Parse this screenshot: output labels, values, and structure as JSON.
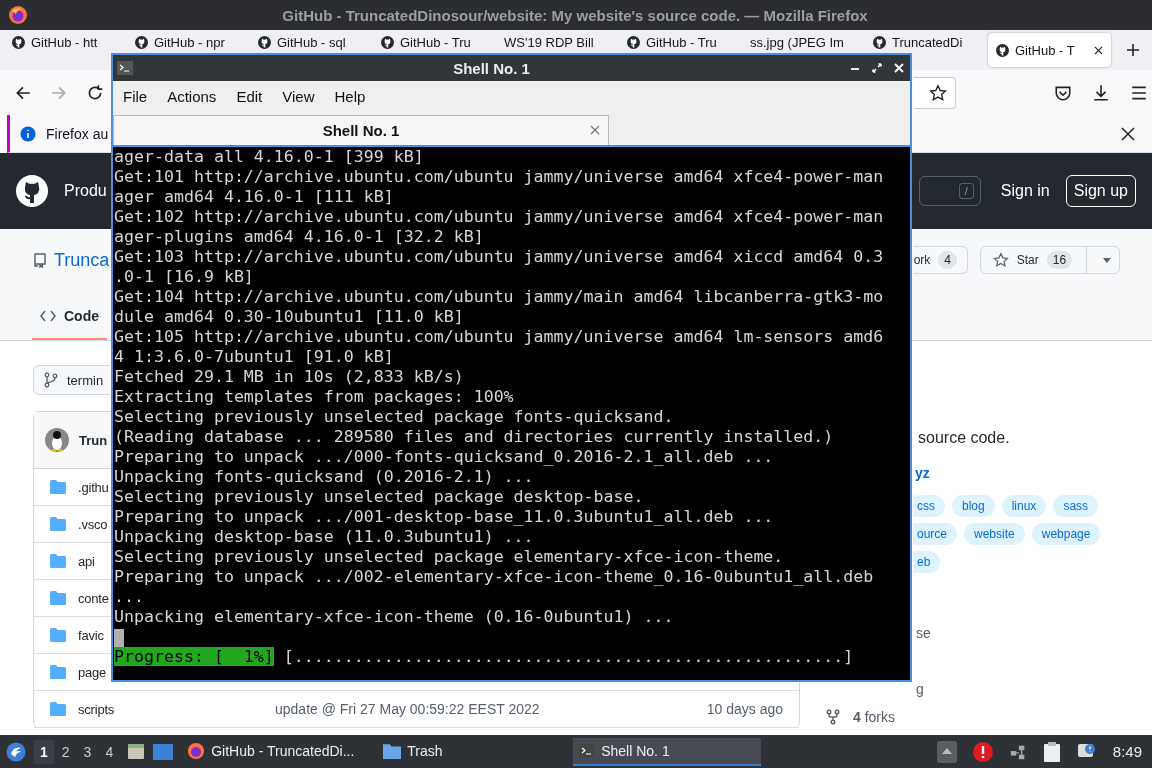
{
  "window": {
    "title": "GitHub - TruncatedDinosour/website: My website's source code. — Mozilla Firefox"
  },
  "browser_tabs": [
    {
      "label": "GitHub - htt",
      "kind": "github",
      "selected": false
    },
    {
      "label": "GitHub - npr",
      "kind": "github",
      "selected": false
    },
    {
      "label": "GitHub - sql",
      "kind": "github",
      "selected": false
    },
    {
      "label": "GitHub - Tru",
      "kind": "github",
      "selected": false
    },
    {
      "label": "WS'19 RDP Bill",
      "kind": "plain",
      "selected": false
    },
    {
      "label": "GitHub - Tru",
      "kind": "github",
      "selected": false
    },
    {
      "label": "ss.jpg (JPEG Im",
      "kind": "plain",
      "selected": false
    },
    {
      "label": "TruncatedDi",
      "kind": "github",
      "selected": false
    },
    {
      "label": "GitHub - T",
      "kind": "github",
      "selected": true
    }
  ],
  "notification": {
    "text": "Firefox au"
  },
  "github_header": {
    "nav_item": "Produ",
    "search_key": "/",
    "sign_in": "Sign in",
    "sign_up": "Sign up"
  },
  "repo": {
    "name": "Trunca",
    "fork": {
      "label": "ork",
      "count": "4"
    },
    "star": {
      "label": "Star",
      "count": "16"
    },
    "tabs": [
      {
        "label": "Code",
        "selected": true
      }
    ]
  },
  "branch": "termin",
  "files": {
    "header": "Trun",
    "rows": [
      {
        "name": ".githu"
      },
      {
        "name": ".vsco"
      },
      {
        "name": "api"
      },
      {
        "name": "conte"
      },
      {
        "name": "favic"
      },
      {
        "name": "page"
      },
      {
        "name": "scripts",
        "message": "update @ Fri 27 May 00:59:22 EEST 2022",
        "age": "10 days ago"
      }
    ]
  },
  "about": {
    "description": "source code.",
    "link": "yz",
    "topic_rows": [
      [
        "css",
        "blog",
        "linux",
        "sass"
      ],
      [
        "ource",
        "website",
        "webpage"
      ],
      [
        "eb"
      ]
    ],
    "fragments": [
      "se",
      "g"
    ],
    "forks": "**4** forks"
  },
  "terminal": {
    "title": "Shell No. 1",
    "menu": [
      "File",
      "Actions",
      "Edit",
      "View",
      "Help"
    ],
    "tabs": [
      {
        "label": "Shell No. 1",
        "selected": true
      }
    ],
    "lines": [
      "ager-data all 4.16.0-1 [399 kB]",
      "Get:101 http://archive.ubuntu.com/ubuntu jammy/universe amd64 xfce4-power-man",
      "ager amd64 4.16.0-1 [111 kB]",
      "Get:102 http://archive.ubuntu.com/ubuntu jammy/universe amd64 xfce4-power-man",
      "ager-plugins amd64 4.16.0-1 [32.2 kB]",
      "Get:103 http://archive.ubuntu.com/ubuntu jammy/universe amd64 xiccd amd64 0.3",
      ".0-1 [16.9 kB]",
      "Get:104 http://archive.ubuntu.com/ubuntu jammy/main amd64 libcanberra-gtk3-mo",
      "dule amd64 0.30-10ubuntu1 [11.0 kB]",
      "Get:105 http://archive.ubuntu.com/ubuntu jammy/universe amd64 lm-sensors amd6",
      "4 1:3.6.0-7ubuntu1 [91.0 kB]",
      "Fetched 29.1 MB in 10s (2,833 kB/s)",
      "Extracting templates from packages: 100%",
      "Selecting previously unselected package fonts-quicksand.",
      "(Reading database ... 289580 files and directories currently installed.)",
      "Preparing to unpack .../000-fonts-quicksand_0.2016-2.1_all.deb ...",
      "Unpacking fonts-quicksand (0.2016-2.1) ...",
      "Selecting previously unselected package desktop-base.",
      "Preparing to unpack .../001-desktop-base_11.0.3ubuntu1_all.deb ...",
      "Unpacking desktop-base (11.0.3ubuntu1) ...",
      "Selecting previously unselected package elementary-xfce-icon-theme.",
      "Preparing to unpack .../002-elementary-xfce-icon-theme_0.16-0ubuntu1_all.deb",
      "...",
      "Unpacking elementary-xfce-icon-theme (0.16-0ubuntu1) ..."
    ],
    "cursor": true,
    "progress": {
      "label": "Progress: [  1%]",
      "bar": "[.......................................................]"
    }
  },
  "taskbar": {
    "workspaces": [
      {
        "label": "1",
        "selected": true
      },
      {
        "label": "2",
        "selected": false
      },
      {
        "label": "3",
        "selected": false
      },
      {
        "label": "4",
        "selected": false
      }
    ],
    "tasks": [
      {
        "label": "GitHub - TruncatedDi...",
        "kind": "browser",
        "selected": false
      },
      {
        "label": "Trash",
        "kind": "folder",
        "selected": false
      },
      {
        "label": "Shell No. 1",
        "kind": "terminal",
        "selected": true
      }
    ],
    "clock": "8:49"
  }
}
